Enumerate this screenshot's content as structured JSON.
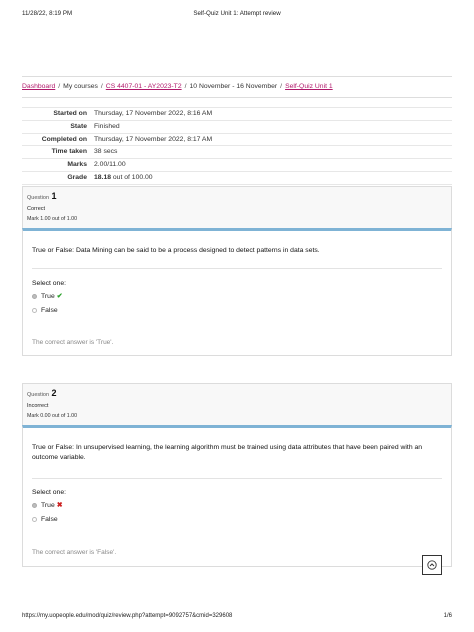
{
  "print": {
    "datetime": "11/28/22, 8:19 PM",
    "title": "Self-Quiz Unit 1: Attempt review",
    "url": "https://my.uopeople.edu/mod/quiz/review.php?attempt=9092757&cmid=329608",
    "page": "1/6"
  },
  "breadcrumb": {
    "items": [
      "Dashboard",
      "My courses",
      "CS 4407-01 - AY2023-T2",
      "10 November - 16 November",
      "Self-Quiz Unit 1"
    ],
    "separator": "/"
  },
  "summary": {
    "rows": [
      {
        "label": "Started on",
        "value": "Thursday, 17 November 2022, 8:16 AM"
      },
      {
        "label": "State",
        "value": "Finished"
      },
      {
        "label": "Completed on",
        "value": "Thursday, 17 November 2022, 8:17 AM"
      },
      {
        "label": "Time taken",
        "value": "38 secs"
      },
      {
        "label": "Marks",
        "value": "2.00/11.00"
      }
    ],
    "grade_label": "Grade",
    "grade_value": "18.18",
    "grade_suffix": "out of 100.00"
  },
  "questions": [
    {
      "label": "Question",
      "number": "1",
      "state": "Correct",
      "mark": "Mark 1.00 out of 1.00",
      "text": "True or False: Data Mining can be said to be a process designed to detect patterns in data sets.",
      "select_one": "Select one:",
      "options": [
        "True",
        "False"
      ],
      "selected": "True",
      "result": "correct",
      "answer": "The correct answer is 'True'."
    },
    {
      "label": "Question",
      "number": "2",
      "state": "Incorrect",
      "mark": "Mark 0.00 out of 1.00",
      "text": "True or False: In unsupervised learning, the learning algorithm must be trained using data attributes that have been paired with an outcome variable.",
      "select_one": "Select one:",
      "options": [
        "True",
        "False"
      ],
      "selected": "True",
      "result": "incorrect",
      "answer": "The correct answer is 'False'."
    }
  ],
  "icons": {
    "correct": "check-icon",
    "incorrect": "cross-icon",
    "scroll_top": "chevron-up-icon"
  },
  "colors": {
    "link": "#b0186a",
    "question_accent": "#7fb3d5",
    "correct": "#2aa02a",
    "incorrect": "#cc2222"
  }
}
